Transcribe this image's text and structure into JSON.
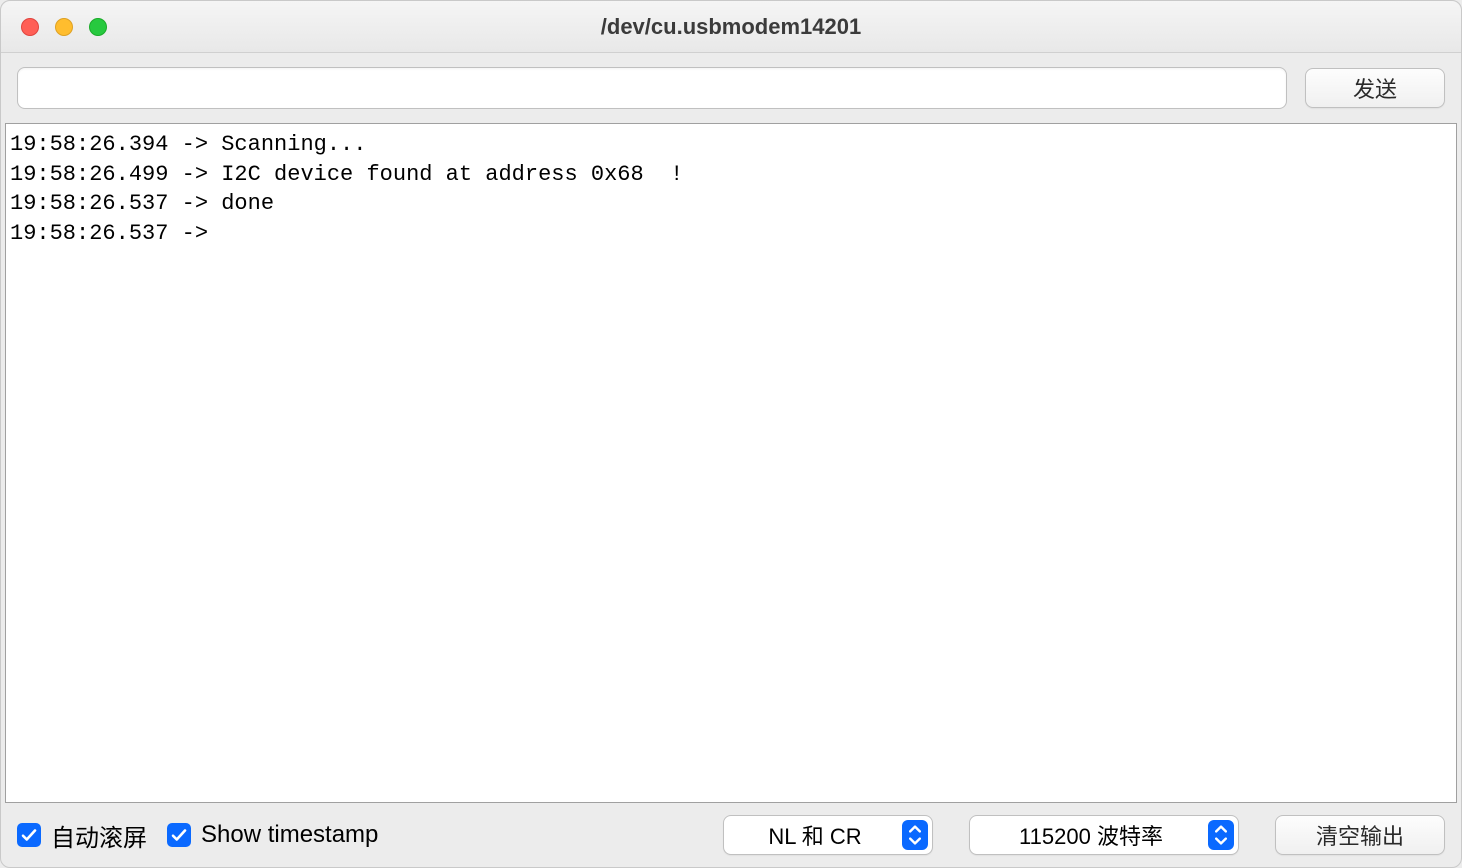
{
  "window": {
    "title": "/dev/cu.usbmodem14201"
  },
  "input_row": {
    "command_value": "",
    "send_label": "发送"
  },
  "output": {
    "lines": [
      {
        "timestamp": "19:58:26.394",
        "arrow": "->",
        "text": "Scanning..."
      },
      {
        "timestamp": "19:58:26.499",
        "arrow": "->",
        "text": "I2C device found at address 0x68  !"
      },
      {
        "timestamp": "19:58:26.537",
        "arrow": "->",
        "text": "done"
      },
      {
        "timestamp": "19:58:26.537",
        "arrow": "->",
        "text": ""
      }
    ]
  },
  "bottom": {
    "autoscroll_checked": true,
    "autoscroll_label": "自动滚屏",
    "timestamp_checked": true,
    "timestamp_label": "Show timestamp",
    "line_ending_selected": "NL 和 CR",
    "baud_selected": "115200 波特率",
    "clear_label": "清空输出"
  }
}
